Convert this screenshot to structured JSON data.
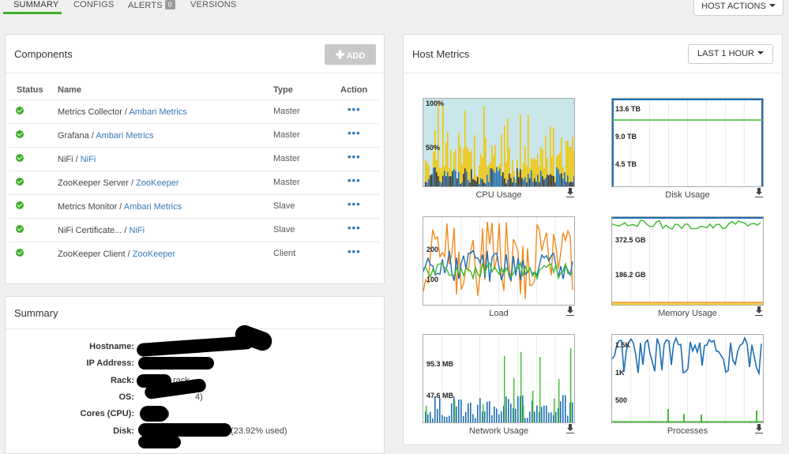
{
  "tabs": [
    {
      "label": "SUMMARY"
    },
    {
      "label": "CONFIGS"
    },
    {
      "label": "ALERTS",
      "badge": "0"
    },
    {
      "label": "VERSIONS"
    }
  ],
  "host_actions_label": "HOST ACTIONS",
  "components": {
    "title": "Components",
    "add_label": "ADD",
    "headers": {
      "status": "Status",
      "name": "Name",
      "type": "Type",
      "action": "Action"
    },
    "rows": [
      {
        "component": "Metrics Collector",
        "service": "Ambari Metrics",
        "type": "Master"
      },
      {
        "component": "Grafana",
        "service": "Ambari Metrics",
        "type": "Master"
      },
      {
        "component": "NiFi",
        "service": "NiFi",
        "type": "Master"
      },
      {
        "component": "ZooKeeper Server",
        "service": "ZooKeeper",
        "type": "Master"
      },
      {
        "component": "Metrics Monitor",
        "service": "Ambari Metrics",
        "type": "Slave"
      },
      {
        "component": "NiFi Certificate...",
        "service": "NiFi",
        "type": "Slave"
      },
      {
        "component": "ZooKeeper Client",
        "service": "ZooKeeper",
        "type": "Client"
      }
    ],
    "separator": " / ",
    "status_color": "#3fae2a",
    "action_icon": "ellipsis-icon"
  },
  "summary": {
    "title": "Summary",
    "labels": {
      "hostname": "Hostname:",
      "ip": "IP Address:",
      "rack": "Rack:",
      "os": "OS:",
      "cores": "Cores (CPU):",
      "disk": "Disk:"
    },
    "visible_fragments": {
      "rack_tail": "rack",
      "os_tail": "4)",
      "cores_tail": "4)",
      "disk_tail": "(23.92% used)"
    }
  },
  "host_metrics": {
    "title": "Host Metrics",
    "range_label": "LAST 1 HOUR",
    "charts": [
      {
        "title": "CPU Usage",
        "y_labels": [
          "100%",
          "50%"
        ]
      },
      {
        "title": "Disk Usage",
        "y_labels": [
          "13.6 TB",
          "9.0 TB",
          "4.5 TB"
        ]
      },
      {
        "title": "Load",
        "y_labels": [
          "200",
          "100"
        ]
      },
      {
        "title": "Memory Usage",
        "y_labels": [
          "372.5 GB",
          "186.2 GB"
        ]
      },
      {
        "title": "Network Usage",
        "y_labels": [
          "95.3 MB",
          "47.6 MB"
        ]
      },
      {
        "title": "Processes",
        "y_labels": [
          "1.5K",
          "1K",
          "500"
        ]
      }
    ],
    "colors": {
      "blue": "#1f6fb4",
      "yellow": "#f2c500",
      "green": "#3dbb2c",
      "orange": "#f38a1e",
      "dark": "#333333",
      "cpu_bg": "#c9e6ea"
    }
  }
}
